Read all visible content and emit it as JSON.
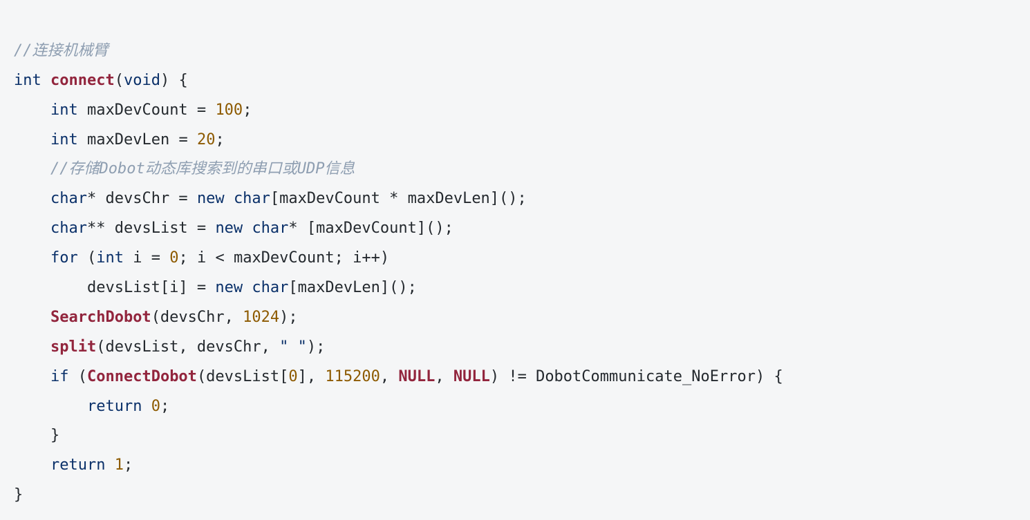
{
  "code": {
    "c1": "//连接机械臂",
    "l2_int": "int",
    "l2_fn": "connect",
    "l2_void": "void",
    "l3_int": "int",
    "l3_var": "maxDevCount",
    "l3_eq": " = ",
    "l3_val": "100",
    "l4_int": "int",
    "l4_var": "maxDevLen",
    "l4_eq": " = ",
    "l4_val": "20",
    "c5": "//存储Dobot动态库搜索到的串口或UDP信息",
    "l6_char": "char",
    "l6_star": "*",
    "l6_var": "devsChr",
    "l6_new": "new",
    "l6_char2": "char",
    "l6_expr": "[maxDevCount * maxDevLen]();",
    "l7_char": "char",
    "l7_star": "**",
    "l7_var": "devsList",
    "l7_new": "new",
    "l7_char2": "char",
    "l7_star2": "*",
    "l7_expr": " [maxDevCount]();",
    "l8_for": "for",
    "l8_int": "int",
    "l8_i": "i",
    "l8_eq": " = ",
    "l8_zero": "0",
    "l8_cond": "; i < maxDevCount; i++)",
    "l9_lhs": "devsList[i] = ",
    "l9_new": "new",
    "l9_char": "char",
    "l9_rest": "[maxDevLen]();",
    "l10_fn": "SearchDobot",
    "l10_args_a": "(devsChr, ",
    "l10_num": "1024",
    "l10_args_b": ");",
    "l11_fn": "split",
    "l11_a": "(devsList, devsChr, ",
    "l11_str": "\" \"",
    "l11_b": ");",
    "l12_if": "if",
    "l12_open": " (",
    "l12_fn": "ConnectDobot",
    "l12_a": "(devsList[",
    "l12_zero": "0",
    "l12_b": "], ",
    "l12_baud": "115200",
    "l12_c": ", ",
    "l12_null1": "NULL",
    "l12_d": ", ",
    "l12_null2": "NULL",
    "l12_e": ") != DobotCommunicate_NoError) {",
    "l13_ret": "return",
    "l13_zero": "0",
    "l14_brace": "}",
    "l15_ret": "return",
    "l15_one": "1",
    "l16_brace": "}"
  }
}
